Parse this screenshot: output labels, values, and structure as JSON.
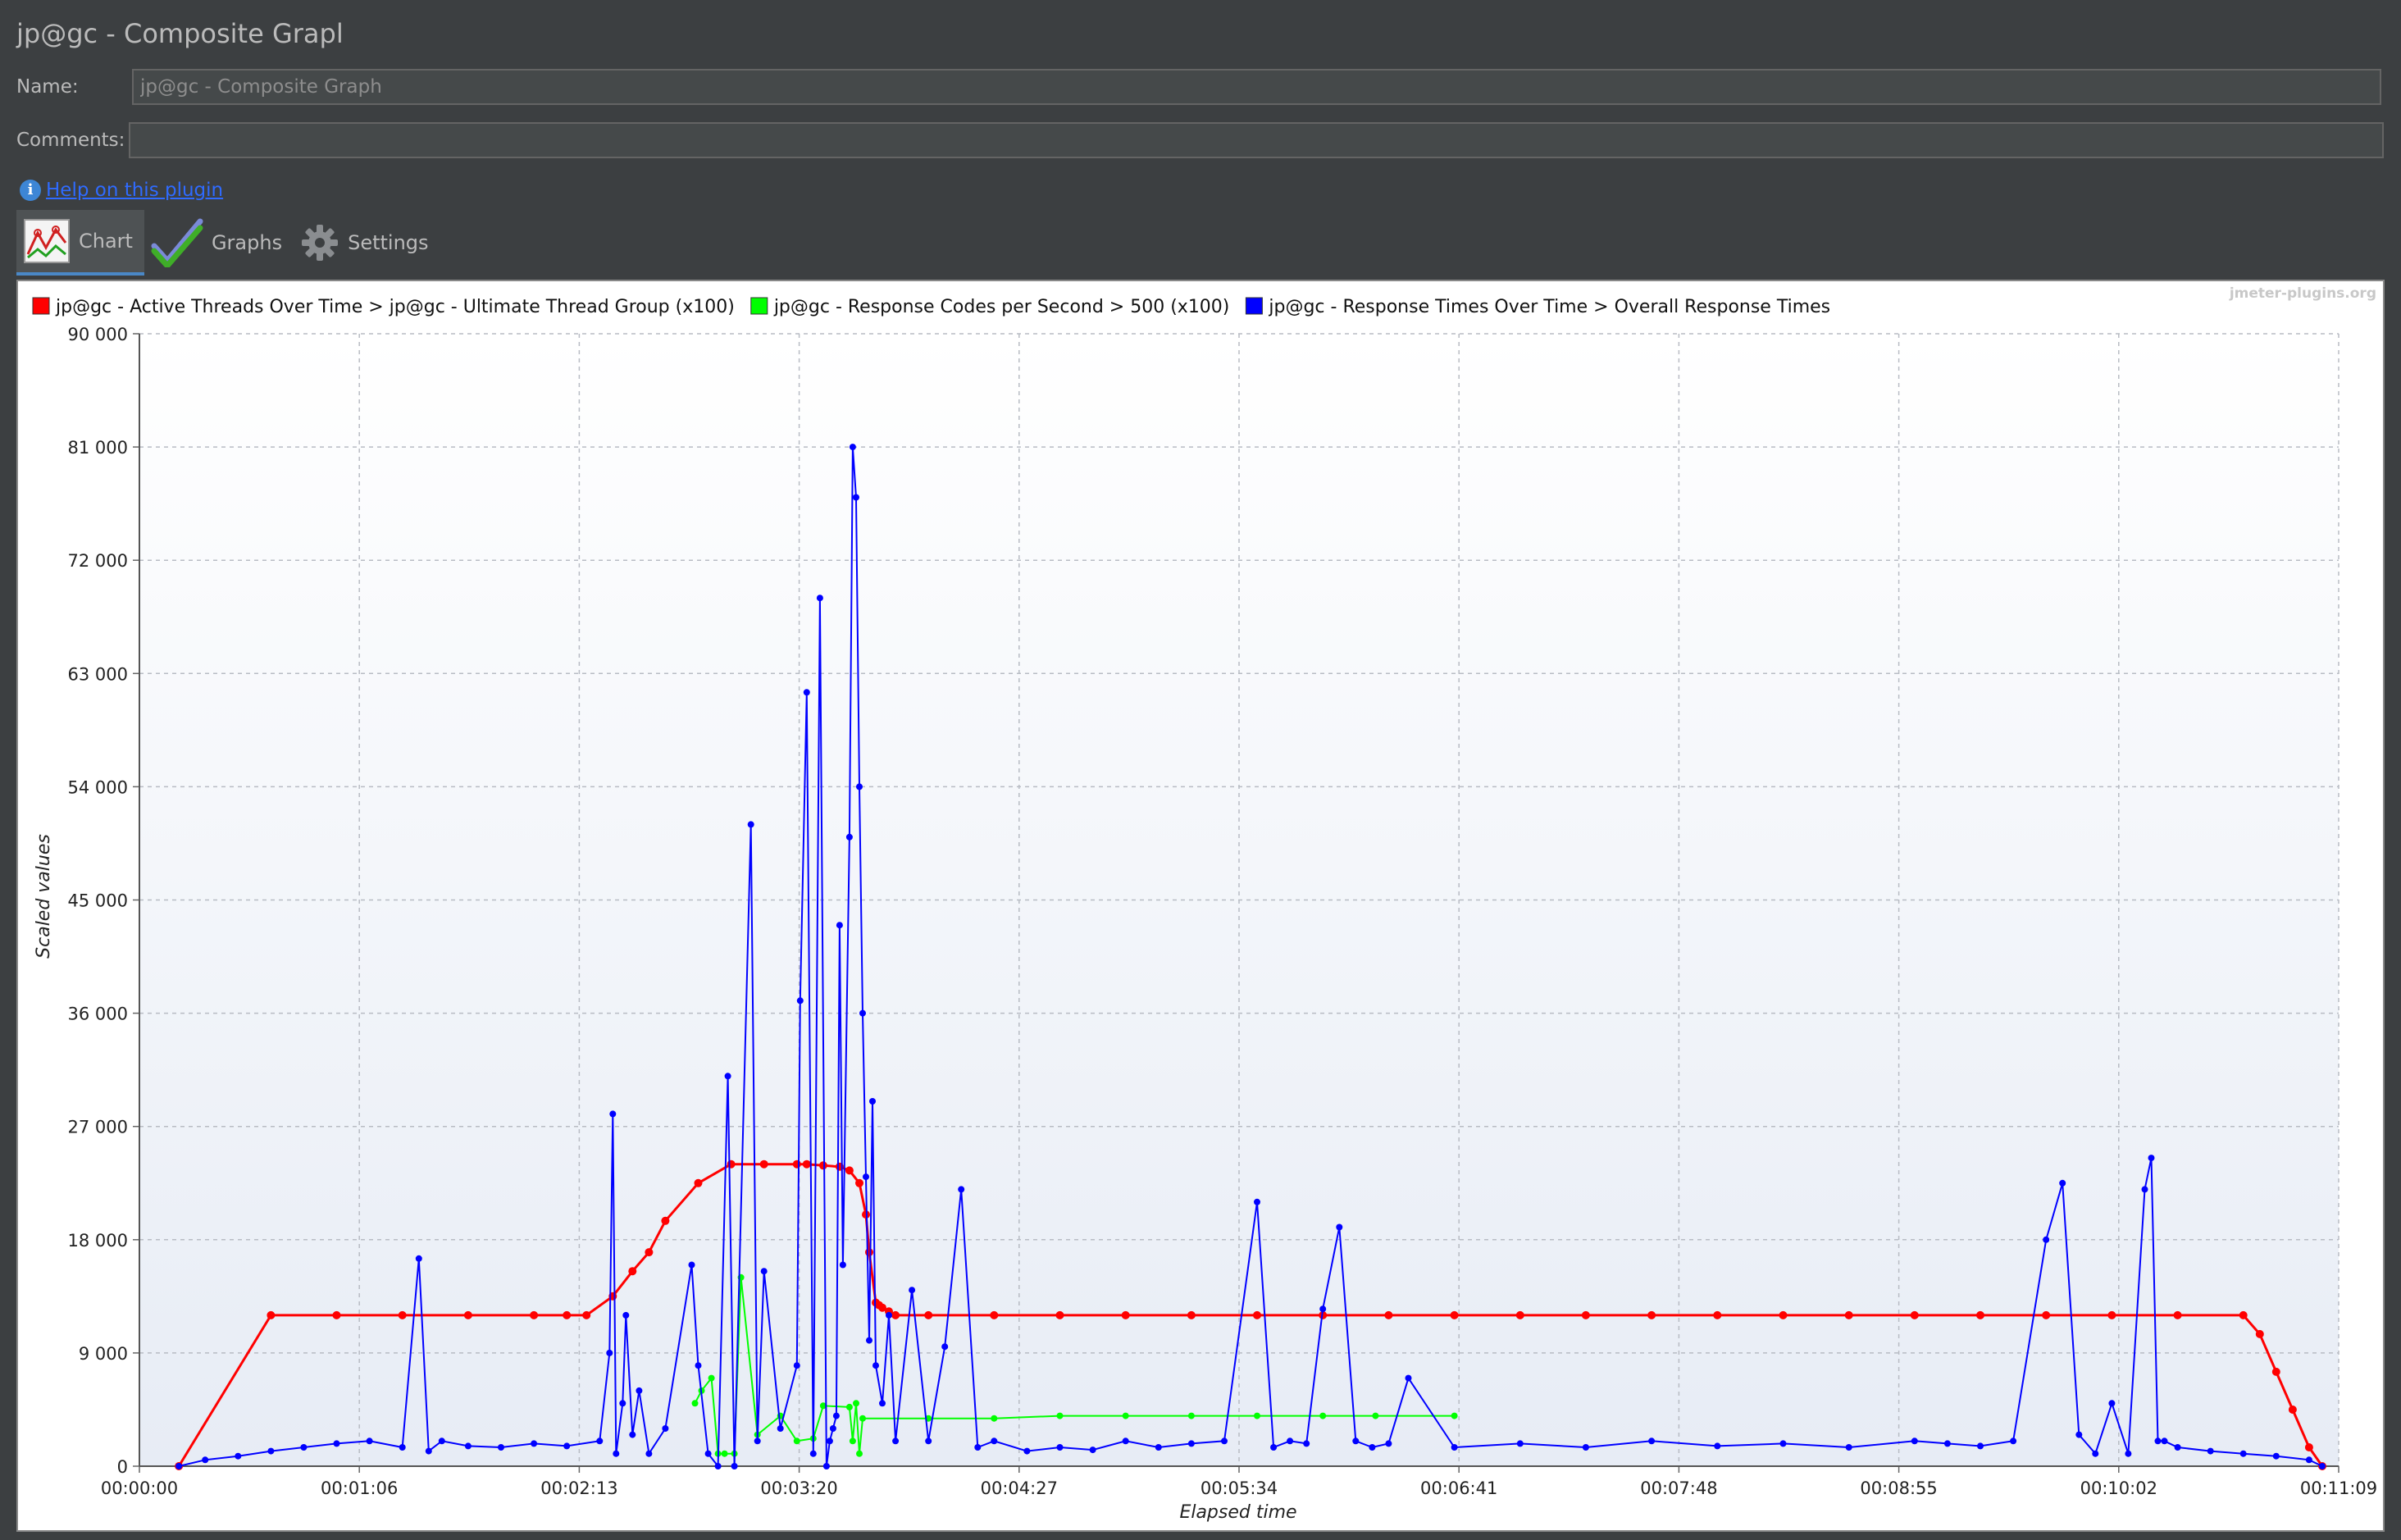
{
  "window": {
    "title": "jp@gc - Composite Grapl"
  },
  "form": {
    "name_label": "Name:",
    "name_value": "jp@gc - Composite Graph",
    "comments_label": "Comments:",
    "comments_value": ""
  },
  "help": {
    "link_text": "Help on this plugin"
  },
  "tabs": [
    {
      "label": "Chart",
      "icon": "line-chart-icon",
      "active": true
    },
    {
      "label": "Graphs",
      "icon": "checkmark-icon",
      "active": false
    },
    {
      "label": "Settings",
      "icon": "gear-icon",
      "active": false
    }
  ],
  "watermark": "jmeter-plugins.org",
  "chart_data": {
    "type": "line",
    "title": "",
    "xlabel": "Elapsed time",
    "ylabel": "Scaled values",
    "x_unit": "elapsed seconds",
    "xlim": [
      0,
      669
    ],
    "ylim": [
      0,
      90000
    ],
    "x_ticks": [
      "00:00:00",
      "00:01:06",
      "00:02:13",
      "00:03:20",
      "00:04:27",
      "00:05:34",
      "00:06:41",
      "00:07:48",
      "00:08:55",
      "00:10:02",
      "00:11:09"
    ],
    "y_ticks": [
      "0",
      "9 000",
      "18 000",
      "27 000",
      "36 000",
      "45 000",
      "54 000",
      "63 000",
      "72 000",
      "81 000",
      "90 000"
    ],
    "grid": true,
    "legend_position": "top",
    "series": [
      {
        "name": "jp@gc - Active Threads Over Time > jp@gc - Ultimate Thread Group (x100)",
        "color": "#ff0000",
        "x": [
          12,
          40,
          60,
          80,
          100,
          120,
          130,
          136,
          144,
          150,
          155,
          160,
          170,
          180,
          190,
          200,
          203,
          208,
          213,
          216,
          219,
          221,
          222,
          224,
          225,
          226,
          228,
          230,
          240,
          260,
          280,
          300,
          320,
          340,
          360,
          380,
          400,
          420,
          440,
          460,
          480,
          500,
          520,
          540,
          560,
          580,
          600,
          620,
          640,
          645,
          650,
          655,
          660,
          664
        ],
        "y": [
          0,
          12000,
          12000,
          12000,
          12000,
          12000,
          12000,
          12000,
          13500,
          15500,
          17000,
          19500,
          22500,
          24000,
          24000,
          24000,
          24000,
          23900,
          23800,
          23500,
          22500,
          20000,
          17000,
          13000,
          12800,
          12600,
          12300,
          12000,
          12000,
          12000,
          12000,
          12000,
          12000,
          12000,
          12000,
          12000,
          12000,
          12000,
          12000,
          12000,
          12000,
          12000,
          12000,
          12000,
          12000,
          12000,
          12000,
          12000,
          12000,
          10500,
          7500,
          4500,
          1500,
          0
        ]
      },
      {
        "name": "jp@gc - Response Codes per Second > 500 (x100)",
        "color": "#00ff00",
        "x": [
          169,
          171,
          174,
          176,
          178,
          181,
          183,
          188,
          195,
          200,
          205,
          208,
          216,
          217,
          218,
          219,
          220,
          240,
          260,
          280,
          300,
          320,
          340,
          360,
          376,
          400
        ],
        "y": [
          5000,
          6000,
          7000,
          1000,
          1000,
          1000,
          15000,
          2500,
          4000,
          2000,
          2200,
          4800,
          4700,
          2000,
          5000,
          1000,
          3800,
          3800,
          3800,
          4000,
          4000,
          4000,
          4000,
          4000,
          4000,
          4000
        ]
      },
      {
        "name": "jp@gc - Response Times Over Time > Overall Response Times",
        "color": "#0000ff",
        "x": [
          12,
          20,
          30,
          40,
          50,
          60,
          70,
          80,
          85,
          88,
          92,
          100,
          110,
          120,
          130,
          140,
          143,
          144,
          145,
          147,
          148,
          150,
          152,
          155,
          160,
          168,
          170,
          173,
          176,
          179,
          181,
          186,
          188,
          190,
          195,
          200,
          201,
          203,
          205,
          207,
          209,
          210,
          211,
          212,
          213,
          214,
          216,
          217,
          218,
          219,
          220,
          221,
          222,
          223,
          224,
          226,
          228,
          230,
          235,
          240,
          245,
          250,
          255,
          260,
          270,
          280,
          290,
          300,
          310,
          320,
          330,
          340,
          345,
          350,
          355,
          360,
          365,
          370,
          375,
          380,
          386,
          400,
          420,
          440,
          460,
          480,
          500,
          520,
          540,
          550,
          560,
          570,
          580,
          585,
          590,
          595,
          600,
          605,
          610,
          612,
          614,
          616,
          620,
          630,
          640,
          650,
          660,
          664
        ],
        "y": [
          0,
          500,
          800,
          1200,
          1500,
          1800,
          2000,
          1500,
          16500,
          1200,
          2000,
          1600,
          1500,
          1800,
          1600,
          2000,
          9000,
          28000,
          1000,
          5000,
          12000,
          2500,
          6000,
          1000,
          3000,
          16000,
          8000,
          1000,
          0,
          31000,
          0,
          51000,
          2000,
          15500,
          3000,
          8000,
          37000,
          61500,
          1000,
          69000,
          0,
          2000,
          3000,
          4000,
          43000,
          16000,
          50000,
          81000,
          77000,
          54000,
          36000,
          23000,
          10000,
          29000,
          8000,
          5000,
          12000,
          2000,
          14000,
          2000,
          9500,
          22000,
          1500,
          2000,
          1200,
          1500,
          1300,
          2000,
          1500,
          1800,
          2000,
          21000,
          1500,
          2000,
          1800,
          12500,
          19000,
          2000,
          1500,
          1800,
          7000,
          1500,
          1800,
          1500,
          2000,
          1600,
          1800,
          1500,
          2000,
          1800,
          1600,
          2000,
          18000,
          22500,
          2500,
          1000,
          5000,
          1000,
          22000,
          24500,
          2000,
          2000,
          1500,
          1200,
          1000,
          800,
          500,
          0
        ]
      }
    ]
  }
}
